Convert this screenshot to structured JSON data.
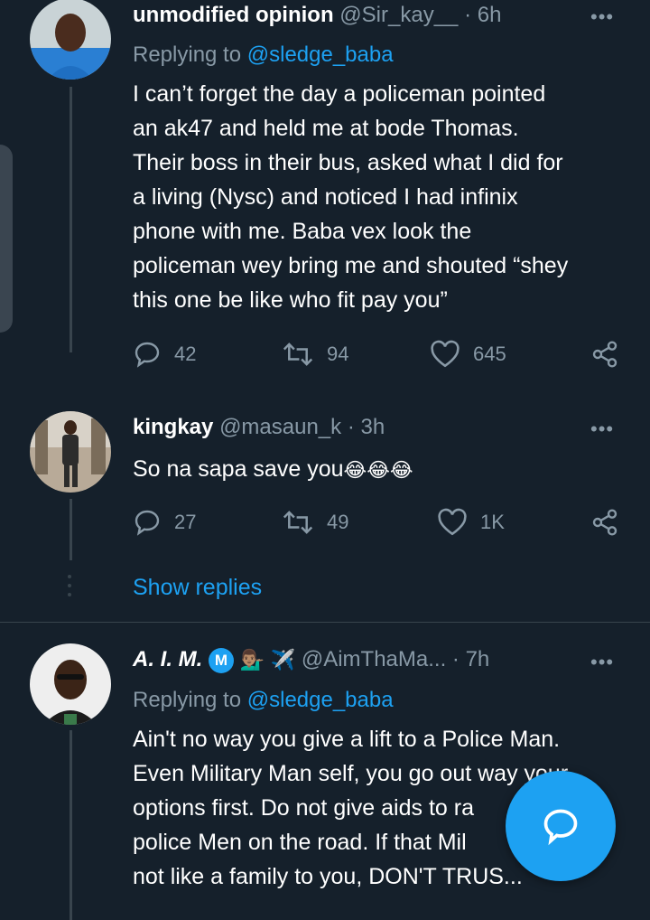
{
  "tweet1": {
    "display_name": "unmodified opinion",
    "handle": "@Sir_kay__",
    "time": "· 6h",
    "replying_prefix": "Replying to ",
    "replying_to": "@sledge_baba",
    "body_lines": [
      "I can’t forget the day a policeman pointed",
      "an ak47 and held me at bode Thomas.",
      "Their boss in their bus, asked what I did for",
      "a living (Nysc) and noticed I had infinix",
      "phone with me. Baba vex look the",
      "policeman wey bring me and shouted “shey",
      "this one be like who fit pay you”"
    ],
    "replies": "42",
    "retweets": "94",
    "likes": "645"
  },
  "tweet2": {
    "display_name": "kingkay",
    "handle": "@masaun_k",
    "time": "· 3h",
    "body": "So na sapa save you",
    "emojis": "😂😂😂",
    "replies": "27",
    "retweets": "49",
    "likes": "1K"
  },
  "show_replies": "Show replies",
  "tweet3": {
    "display_name": "A. I. M.",
    "badge": "M",
    "emoji_a": "💁🏽‍♂️",
    "emoji_b": "✈️",
    "handle": "@AimThaMa...",
    "time": "· 7h",
    "replying_prefix": "Replying to ",
    "replying_to": "@sledge_baba",
    "body_lines": [
      "Ain't no way you give a lift to a Police Man.",
      "Even Military Man self, you go out way your",
      "options first. Do not give aids to ra",
      "police Men on the road. If that Mil",
      "not like a family to you, DON'T TRUS..."
    ]
  },
  "more_label": "•••",
  "colors": {
    "background": "#15202b",
    "accent": "#1da1f2",
    "secondary_text": "#8899a6",
    "divider": "#38444d"
  },
  "icons": [
    "reply-icon",
    "retweet-icon",
    "like-icon",
    "share-icon",
    "more-icon",
    "compose-reply-icon"
  ]
}
